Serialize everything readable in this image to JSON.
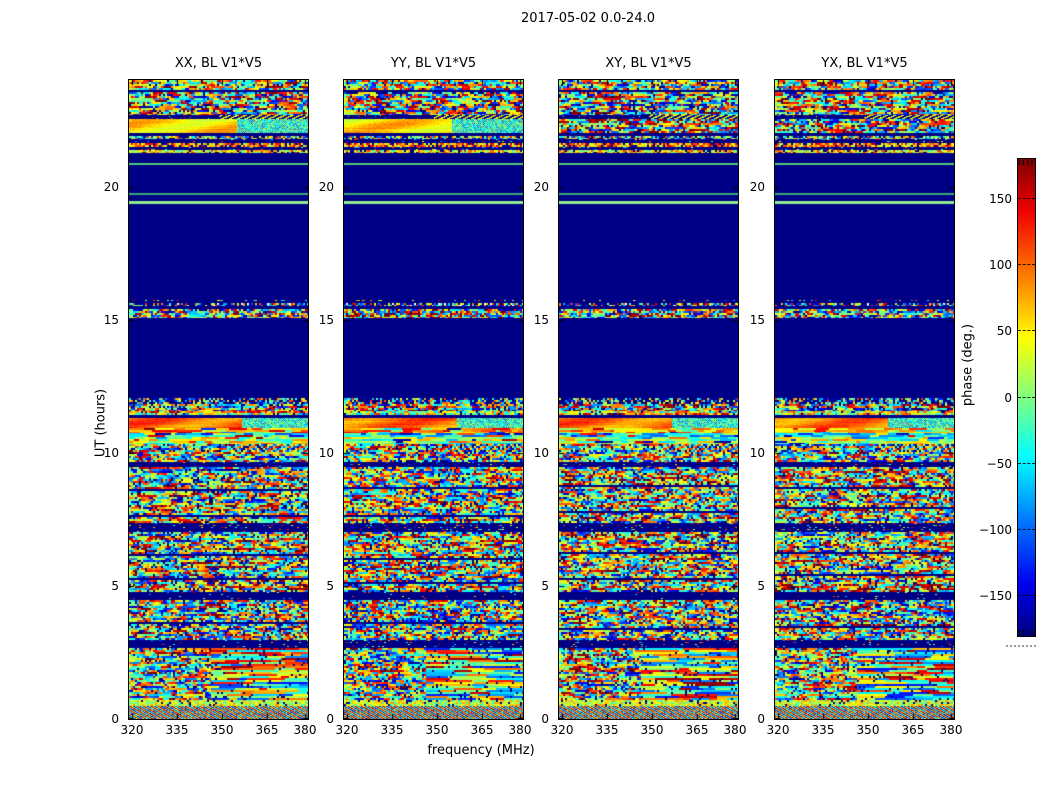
{
  "figure": {
    "title": "2017-05-02 0.0-24.0",
    "background": "#ffffff"
  },
  "axes": {
    "ylabel": "UT (hours)",
    "xlabel": "frequency (MHz)",
    "ytick_labels": [
      "0",
      "5",
      "10",
      "15",
      "20"
    ],
    "ytick_values": [
      0,
      5,
      10,
      15,
      20
    ],
    "xtick_labels": [
      "320",
      "335",
      "350",
      "365",
      "380"
    ],
    "xtick_values": [
      320,
      335,
      350,
      365,
      380
    ]
  },
  "colorbar": {
    "label": "phase (deg.)",
    "tick_labels": [
      "150",
      "100",
      "50",
      "0",
      "−50",
      "−100",
      "−150"
    ],
    "tick_values": [
      150,
      100,
      50,
      0,
      -50,
      -100,
      -150
    ],
    "vmin": -180,
    "vmax": 180,
    "colormap": "jet"
  },
  "chart_data": {
    "type": "heatmap",
    "title": "2017-05-02 0.0-24.0",
    "panels": [
      "XX, BL V1*V5",
      "YY, BL V1*V5",
      "XY, BL V1*V5",
      "YX, BL V1*V5"
    ],
    "x": {
      "label": "frequency (MHz)",
      "ticks": [
        320,
        335,
        350,
        365,
        380
      ],
      "range": [
        318.5,
        380.7
      ],
      "units": "MHz"
    },
    "y": {
      "label": "UT (hours)",
      "ticks": [
        0,
        5,
        10,
        15,
        20
      ],
      "range": [
        0,
        24
      ],
      "units": "hours"
    },
    "z": {
      "label": "phase (deg.)",
      "range": [
        -180,
        180
      ],
      "colormap": "jet"
    },
    "colors": {
      "background_blue": "#000086",
      "line_green_bright": "#8deb8d",
      "line_green_mid": "#4fc87a",
      "line_green_dim": "#3aa877"
    },
    "bands": [
      {
        "t0": 23.62,
        "t1": 24.0,
        "kind": "noise",
        "o": {
          "bias": 0.55,
          "spread": 0.85,
          "density": 0.97,
          "streak": 0.45
        }
      },
      {
        "t0": 23.55,
        "t1": 23.62,
        "kind": "solid"
      },
      {
        "t0": 23.1,
        "t1": 23.55,
        "kind": "noise",
        "o": {
          "bias": 0.55,
          "spread": 0.95,
          "density": 0.95,
          "streak": 0.5
        }
      },
      {
        "t0": 22.68,
        "t1": 23.1,
        "kind": "noise",
        "o": {
          "bias": 0.5,
          "spread": 0.95,
          "density": 0.93,
          "streak": 0.55
        }
      },
      {
        "t0": 22.53,
        "t1": 22.68,
        "kind": "split_diag",
        "o": {
          "bias": 0.62
        }
      },
      {
        "t0": 22.02,
        "t1": 22.53,
        "kind": "smooth",
        "o": {
          "v": 0.66,
          "checkerFrom": 0.6
        },
        "xyKind": "noise",
        "xyO": {
          "bias": 0.6,
          "spread": 0.95,
          "density": 0.92,
          "streak": 0.5
        }
      },
      {
        "t0": 21.89,
        "t1": 22.02,
        "kind": "solid"
      },
      {
        "t0": 21.77,
        "t1": 21.89,
        "kind": "speck",
        "o": {
          "bias": 0.5,
          "spread": 0.7,
          "density": 0.75
        }
      },
      {
        "t0": 21.62,
        "t1": 21.77,
        "kind": "solid_speck",
        "o": {
          "density": 0.12
        }
      },
      {
        "t0": 21.47,
        "t1": 21.62,
        "kind": "speck",
        "o": {
          "bias": 0.72,
          "spread": 0.4,
          "density": 0.8
        }
      },
      {
        "t0": 21.36,
        "t1": 21.47,
        "kind": "solid_speck",
        "o": {
          "density": 0.18
        }
      },
      {
        "t0": 21.25,
        "t1": 21.36,
        "kind": "speck",
        "o": {
          "bias": 0.63,
          "spread": 0.4,
          "density": 0.85
        }
      },
      {
        "t0": 20.88,
        "t1": 21.25,
        "kind": "solid"
      },
      {
        "t0": 20.8,
        "t1": 20.88,
        "kind": "hline",
        "o": {
          "color": "#4fc87a"
        }
      },
      {
        "t0": 19.76,
        "t1": 20.8,
        "kind": "solid"
      },
      {
        "t0": 19.68,
        "t1": 19.76,
        "kind": "hline",
        "o": {
          "color": "#3aa877"
        }
      },
      {
        "t0": 19.45,
        "t1": 19.68,
        "kind": "solid"
      },
      {
        "t0": 19.34,
        "t1": 19.45,
        "kind": "hline",
        "o": {
          "color": "#8deb8d"
        }
      },
      {
        "t0": 15.74,
        "t1": 19.34,
        "kind": "solid"
      },
      {
        "t0": 15.65,
        "t1": 15.74,
        "kind": "solid_speck",
        "o": {
          "density": 0.25
        }
      },
      {
        "t0": 15.5,
        "t1": 15.62,
        "kind": "speck",
        "o": {
          "bias": 0.5,
          "spread": 0.9,
          "density": 0.6,
          "white": 0.06
        }
      },
      {
        "t0": 15.4,
        "t1": 15.5,
        "kind": "solid"
      },
      {
        "t0": 15.05,
        "t1": 15.4,
        "kind": "noise",
        "o": {
          "bias": 0.55,
          "spread": 0.95,
          "density": 0.97,
          "streak": 0.3
        }
      },
      {
        "t0": 12.05,
        "t1": 15.05,
        "kind": "solid"
      },
      {
        "t0": 11.82,
        "t1": 12.05,
        "kind": "speck",
        "o": {
          "bias": 0.45,
          "spread": 0.8,
          "density": 0.5
        }
      },
      {
        "t0": 11.56,
        "t1": 11.82,
        "kind": "noise",
        "o": {
          "bias": 0.55,
          "spread": 0.85,
          "density": 0.85,
          "streak": 0.5
        }
      },
      {
        "t0": 11.41,
        "t1": 11.56,
        "kind": "noise",
        "o": {
          "bias": 0.63,
          "spread": 0.5,
          "density": 0.95,
          "streak": 0.4
        }
      },
      {
        "t0": 11.3,
        "t1": 11.41,
        "kind": "solid"
      },
      {
        "t0": 10.92,
        "t1": 11.3,
        "kind": "smooth",
        "o": {
          "v": 0.76,
          "checkerFrom": 0.63
        }
      },
      {
        "t0": 10.73,
        "t1": 10.92,
        "kind": "streaks",
        "o": {
          "palette": [
            0.65,
            0.75,
            0.8,
            0.55
          ]
        }
      },
      {
        "t0": 10.58,
        "t1": 10.73,
        "kind": "streaks",
        "o": {
          "palette": [
            0.35,
            0.28,
            0.45,
            0.15
          ]
        }
      },
      {
        "t0": 10.32,
        "t1": 10.58,
        "kind": "streaks",
        "o": {
          "palette": [
            0.6,
            0.5,
            0.68,
            0.42
          ]
        }
      },
      {
        "t0": 10.02,
        "t1": 10.32,
        "kind": "noise",
        "o": {
          "bias": 0.55,
          "spread": 0.8,
          "density": 0.85,
          "streak": 0.5,
          "moireFrom": 0.55
        }
      },
      {
        "t0": 9.64,
        "t1": 10.02,
        "kind": "noise",
        "o": {
          "bias": 0.5,
          "spread": 0.9,
          "density": 0.95,
          "streak": 0.4
        }
      },
      {
        "t0": 9.46,
        "t1": 9.64,
        "kind": "solid_speck",
        "o": {
          "density": 0.08
        }
      },
      {
        "t0": 7.35,
        "t1": 9.46,
        "kind": "noise_breaks",
        "o": {
          "bias": 0.55,
          "spread": 0.8,
          "density": 0.9,
          "streak": 0.5,
          "breakEvery": 9
        }
      },
      {
        "t0": 7.02,
        "t1": 7.35,
        "kind": "solid_speck",
        "o": {
          "density": 0.15
        }
      },
      {
        "t0": 4.76,
        "t1": 7.02,
        "kind": "noise_breaks",
        "o": {
          "bias": 0.55,
          "spread": 0.85,
          "density": 0.9,
          "streak": 0.5,
          "breakEvery": 10
        }
      },
      {
        "t0": 4.46,
        "t1": 4.76,
        "kind": "solid_speck",
        "o": {
          "density": 0.05
        }
      },
      {
        "t0": 2.96,
        "t1": 4.46,
        "kind": "noise_breaks",
        "o": {
          "bias": 0.52,
          "spread": 0.9,
          "density": 0.92,
          "streak": 0.45,
          "breakEvery": 11
        }
      },
      {
        "t0": 2.66,
        "t1": 2.96,
        "kind": "solid_speck",
        "o": {
          "density": 0.12
        }
      },
      {
        "t0": 0.7,
        "t1": 2.66,
        "kind": "noise",
        "o": {
          "bias": 0.55,
          "spread": 0.85,
          "density": 0.93,
          "streak": 0.5,
          "rightStreak": true
        }
      },
      {
        "t0": 0.48,
        "t1": 0.7,
        "kind": "speck",
        "o": {
          "bias": 0.58,
          "spread": 0.3,
          "density": 0.9
        }
      },
      {
        "t0": 0.0,
        "t1": 0.48,
        "kind": "moire",
        "o": {
          "fx": 0.9,
          "fy": 1.6,
          "bias": 0.55
        }
      }
    ]
  }
}
